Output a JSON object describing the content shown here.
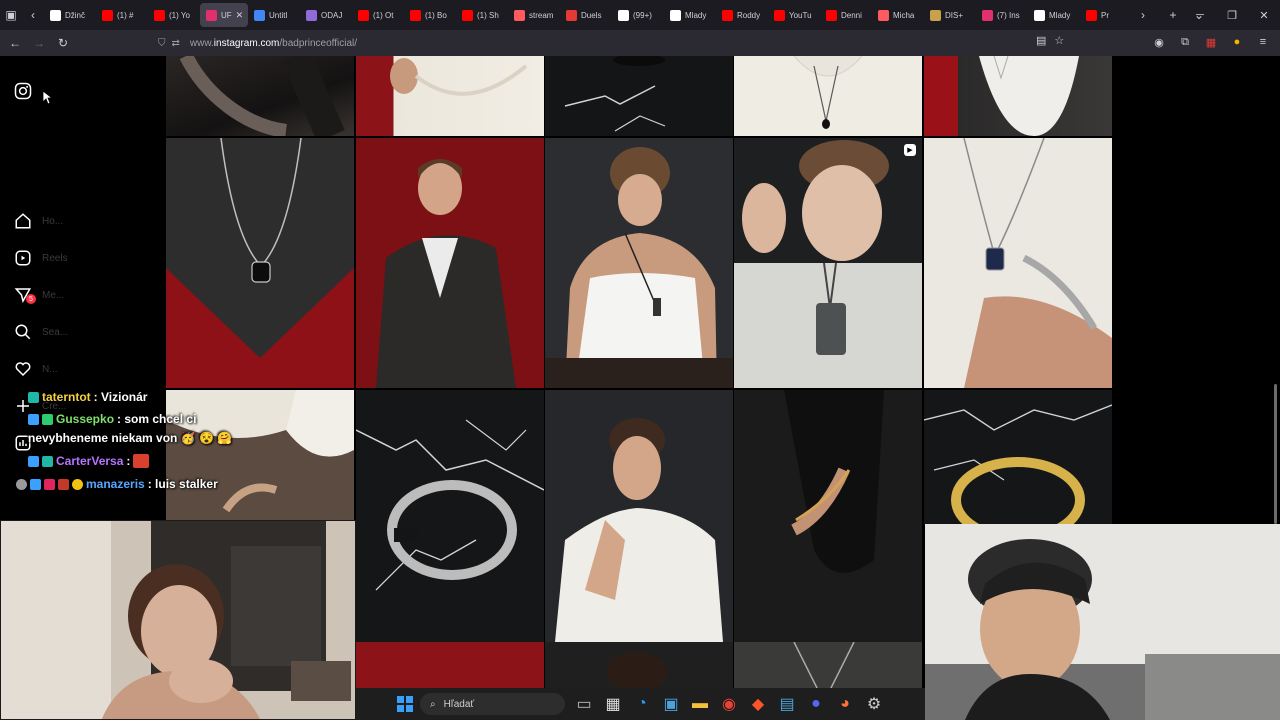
{
  "browser": {
    "tabs": [
      {
        "label": "Džinč",
        "color": "#ffffff"
      },
      {
        "label": "(1) #",
        "color": "#ff0000"
      },
      {
        "label": "(1) Yo",
        "color": "#ff0000"
      },
      {
        "label": "UF",
        "color": "#e1306c",
        "active": true
      },
      {
        "label": "Untitl",
        "color": "#4285f4"
      },
      {
        "label": "ODAJ",
        "color": "#8e6bd8"
      },
      {
        "label": "(1) Ot",
        "color": "#ff0000"
      },
      {
        "label": "(1) Bo",
        "color": "#ff0000"
      },
      {
        "label": "(1) Sh",
        "color": "#ff0000"
      },
      {
        "label": "stream",
        "color": "#ff5a5f"
      },
      {
        "label": "Duels",
        "color": "#e53935"
      },
      {
        "label": "(99+)",
        "color": "#ffffff"
      },
      {
        "label": "Mlady",
        "color": "#ffffff"
      },
      {
        "label": "Roddy",
        "color": "#ff0000"
      },
      {
        "label": "YouTu",
        "color": "#ff0000"
      },
      {
        "label": "Denni",
        "color": "#ff0000"
      },
      {
        "label": "Micha",
        "color": "#ff5a5f"
      },
      {
        "label": "DIS+",
        "color": "#c8a24a"
      },
      {
        "label": "(7) Ins",
        "color": "#e1306c"
      },
      {
        "label": "Mlady",
        "color": "#ffffff"
      },
      {
        "label": "Pr",
        "color": "#ff0000"
      }
    ],
    "url_prefix": "www.",
    "url_host": "instagram.com",
    "url_path": "/badprinceofficial/"
  },
  "sidebar": {
    "items": [
      {
        "label": "Ho...",
        "icon": "home-icon"
      },
      {
        "label": "Reels",
        "icon": "reels-icon"
      },
      {
        "label": "Me...",
        "icon": "messages-icon",
        "badge": "5"
      },
      {
        "label": "Sea...",
        "icon": "search-icon"
      },
      {
        "label": "N...",
        "icon": "heart-icon"
      },
      {
        "label": "Cre...",
        "icon": "plus-icon"
      },
      {
        "label": "",
        "icon": "stats-icon"
      }
    ]
  },
  "chat": [
    {
      "name": "taterntot",
      "name_color": "#f5d142",
      "text": ": Vizionár"
    },
    {
      "name": "Gussepko",
      "name_color": "#7ee06b",
      "text": ": som chcel ci"
    },
    {
      "name": "",
      "name_color": "#ffffff",
      "text": "nevybheneme niekam von 🥳 😵 🤗"
    },
    {
      "name": "CarterVersa",
      "name_color": "#b673ff",
      "text": ":"
    },
    {
      "name": "manazeris",
      "name_color": "#58a6ff",
      "text": ": luis stalker"
    }
  ],
  "taskbar": {
    "search_label": "Hľadať"
  }
}
